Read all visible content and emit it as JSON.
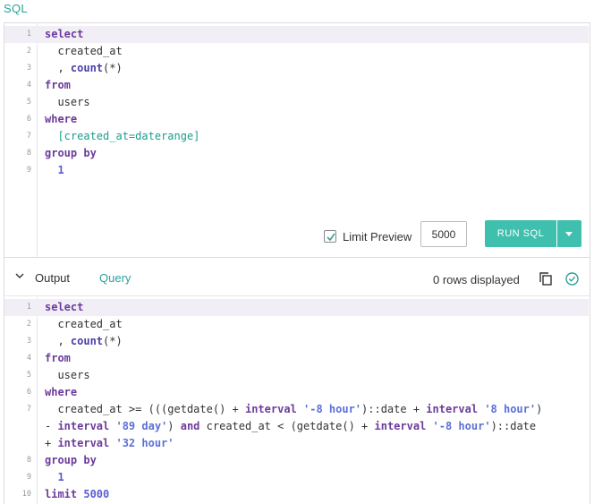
{
  "section_title": "SQL",
  "editor": {
    "lines": [
      {
        "n": "1",
        "tokens": [
          {
            "t": "select",
            "c": "kw"
          }
        ]
      },
      {
        "n": "2",
        "tokens": [
          {
            "t": "  created_at",
            "c": "ident"
          }
        ]
      },
      {
        "n": "3",
        "tokens": [
          {
            "t": "  , ",
            "c": "ident"
          },
          {
            "t": "count",
            "c": "fn"
          },
          {
            "t": "(*)",
            "c": "ident"
          }
        ]
      },
      {
        "n": "4",
        "tokens": [
          {
            "t": "from",
            "c": "kw"
          }
        ]
      },
      {
        "n": "5",
        "tokens": [
          {
            "t": "  users",
            "c": "ident"
          }
        ]
      },
      {
        "n": "6",
        "tokens": [
          {
            "t": "where",
            "c": "kw"
          }
        ]
      },
      {
        "n": "7",
        "tokens": [
          {
            "t": "  [created_at=daterange]",
            "c": "param"
          }
        ]
      },
      {
        "n": "8",
        "tokens": [
          {
            "t": "group by",
            "c": "kw"
          }
        ]
      },
      {
        "n": "9",
        "tokens": [
          {
            "t": "  ",
            "c": "ident"
          },
          {
            "t": "1",
            "c": "num"
          }
        ]
      }
    ]
  },
  "toolbar": {
    "limit_preview_label": "Limit Preview",
    "limit_preview_checked": true,
    "limit_value": "5000",
    "run_label": "RUN SQL"
  },
  "output_header": {
    "output_label": "Output",
    "query_tab": "Query",
    "rows_text": "0 rows displayed"
  },
  "output_code": {
    "lines": [
      {
        "n": "1",
        "tokens": [
          {
            "t": "select",
            "c": "kw"
          }
        ]
      },
      {
        "n": "2",
        "tokens": [
          {
            "t": "  created_at",
            "c": "ident"
          }
        ]
      },
      {
        "n": "3",
        "tokens": [
          {
            "t": "  , ",
            "c": "ident"
          },
          {
            "t": "count",
            "c": "fn"
          },
          {
            "t": "(*)",
            "c": "ident"
          }
        ]
      },
      {
        "n": "4",
        "tokens": [
          {
            "t": "from",
            "c": "kw"
          }
        ]
      },
      {
        "n": "5",
        "tokens": [
          {
            "t": "  users",
            "c": "ident"
          }
        ]
      },
      {
        "n": "6",
        "tokens": [
          {
            "t": "where",
            "c": "kw"
          }
        ]
      },
      {
        "n": "7",
        "tokens": [
          {
            "t": "  created_at >= (((getdate() + ",
            "c": "ident"
          },
          {
            "t": "interval",
            "c": "kw"
          },
          {
            "t": " ",
            "c": "ident"
          },
          {
            "t": "'-8 hour'",
            "c": "str"
          },
          {
            "t": ")::date + ",
            "c": "ident"
          },
          {
            "t": "interval",
            "c": "kw"
          },
          {
            "t": " ",
            "c": "ident"
          },
          {
            "t": "'8 hour'",
            "c": "str"
          },
          {
            "t": ")",
            "c": "ident"
          }
        ]
      },
      {
        "n": "",
        "tokens": [
          {
            "t": "- ",
            "c": "ident"
          },
          {
            "t": "interval",
            "c": "kw"
          },
          {
            "t": " ",
            "c": "ident"
          },
          {
            "t": "'89 day'",
            "c": "str"
          },
          {
            "t": ") ",
            "c": "ident"
          },
          {
            "t": "and",
            "c": "kw"
          },
          {
            "t": " created_at < (getdate() + ",
            "c": "ident"
          },
          {
            "t": "interval",
            "c": "kw"
          },
          {
            "t": " ",
            "c": "ident"
          },
          {
            "t": "'-8 hour'",
            "c": "str"
          },
          {
            "t": ")::date",
            "c": "ident"
          }
        ]
      },
      {
        "n": "",
        "tokens": [
          {
            "t": "+ ",
            "c": "ident"
          },
          {
            "t": "interval",
            "c": "kw"
          },
          {
            "t": " ",
            "c": "ident"
          },
          {
            "t": "'32 hour'",
            "c": "str"
          }
        ]
      },
      {
        "n": "8",
        "tokens": [
          {
            "t": "group by",
            "c": "kw"
          }
        ]
      },
      {
        "n": "9",
        "tokens": [
          {
            "t": "  ",
            "c": "ident"
          },
          {
            "t": "1",
            "c": "num"
          }
        ]
      },
      {
        "n": "10",
        "tokens": [
          {
            "t": "limit",
            "c": "kw"
          },
          {
            "t": " ",
            "c": "ident"
          },
          {
            "t": "5000",
            "c": "num"
          }
        ]
      }
    ]
  },
  "icons": {
    "collapse": "chevron-down-icon",
    "copy": "copy-icon",
    "status": "check-circle-icon"
  },
  "colors": {
    "accent": "#2aa198",
    "run_button": "#3fbfad",
    "active_line": "#f1eef6"
  }
}
